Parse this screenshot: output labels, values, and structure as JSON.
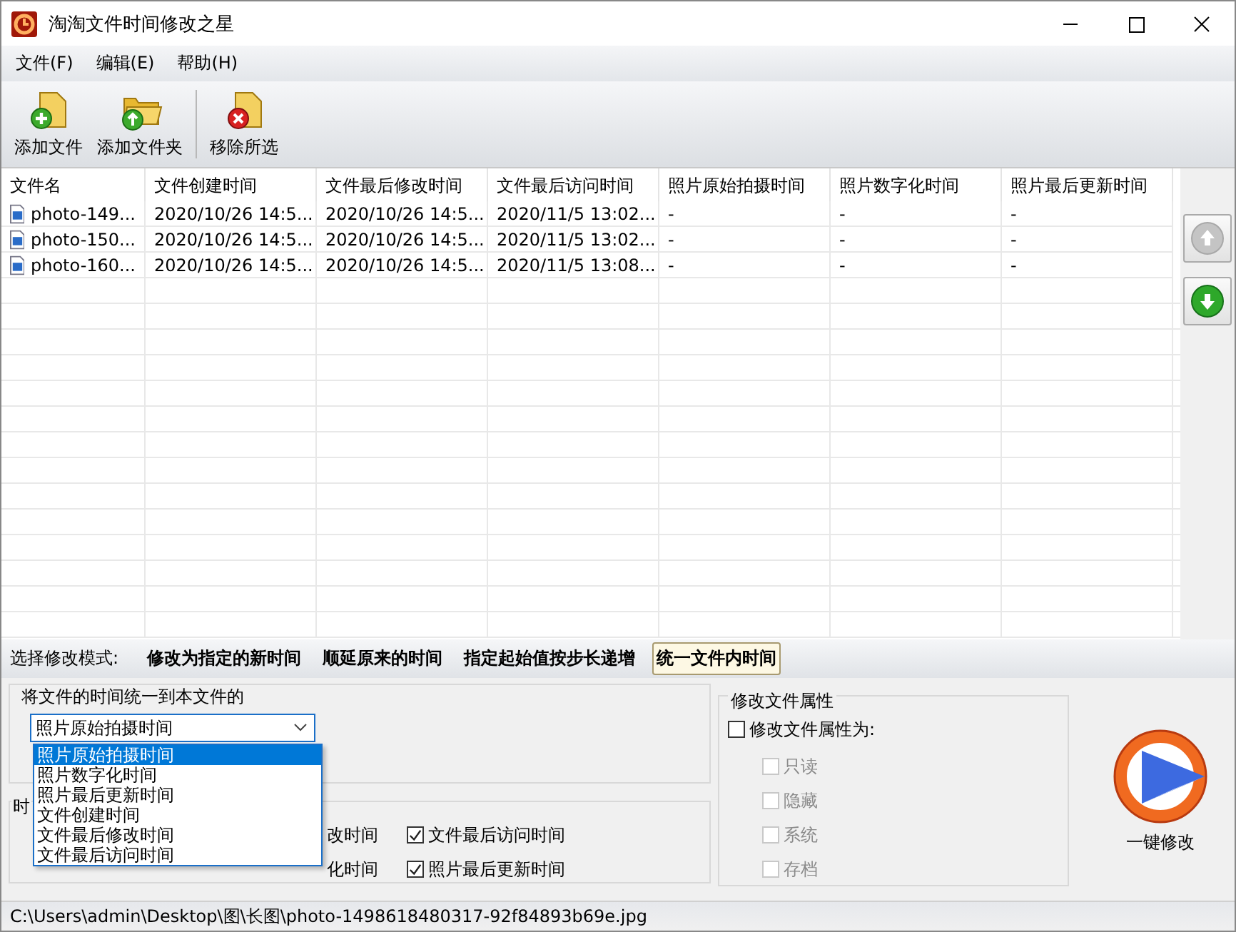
{
  "window": {
    "title": "淘淘文件时间修改之星"
  },
  "menu": [
    {
      "label": "文件(F)"
    },
    {
      "label": "编辑(E)"
    },
    {
      "label": "帮助(H)"
    }
  ],
  "toolbar": [
    {
      "label": "添加文件",
      "kind": "add-file"
    },
    {
      "label": "添加文件夹",
      "kind": "add-folder"
    },
    {
      "label": "移除所选",
      "kind": "remove"
    }
  ],
  "table": {
    "columns": [
      "文件名",
      "文件创建时间",
      "文件最后修改时间",
      "文件最后访问时间",
      "照片原始拍摄时间",
      "照片数字化时间",
      "照片最后更新时间"
    ],
    "rows": [
      {
        "cells": [
          "photo-149...",
          "2020/10/26 14:5...",
          "2020/10/26 14:5...",
          "2020/11/5 13:02...",
          "-",
          "-",
          "-"
        ]
      },
      {
        "cells": [
          "photo-150...",
          "2020/10/26 14:5...",
          "2020/10/26 14:5...",
          "2020/11/5 13:02...",
          "-",
          "-",
          "-"
        ]
      },
      {
        "cells": [
          "photo-160...",
          "2020/10/26 14:5...",
          "2020/10/26 14:5...",
          "2020/11/5 13:08...",
          "-",
          "-",
          "-"
        ]
      }
    ]
  },
  "side_buttons": [
    {
      "kind": "up",
      "disabled": true
    },
    {
      "kind": "down",
      "disabled": false
    }
  ],
  "mode": {
    "label": "选择修改模式:",
    "options": [
      {
        "label": "修改为指定的新时间",
        "selected": false
      },
      {
        "label": "顺延原来的时间",
        "selected": false
      },
      {
        "label": "指定起始值按步长递增",
        "selected": false
      },
      {
        "label": "统一文件内时间",
        "selected": true
      }
    ]
  },
  "unify_group": {
    "title": "将文件的时间统一到本文件的",
    "select": {
      "value": "照片原始拍摄时间",
      "options": [
        {
          "label": "照片原始拍摄时间",
          "selected": true
        },
        {
          "label": "照片数字化时间",
          "selected": false
        },
        {
          "label": "照片最后更新时间",
          "selected": false
        },
        {
          "label": "文件创建时间",
          "selected": false
        },
        {
          "label": "文件最后修改时间",
          "selected": false
        },
        {
          "label": "文件最后访问时间",
          "selected": false
        }
      ]
    }
  },
  "time_group": {
    "title": "时",
    "partial_labels": [
      "改时间",
      "化时间"
    ],
    "checks": [
      {
        "label": "文件最后访问时间",
        "checked": true
      },
      {
        "label": "照片最后更新时间",
        "checked": true
      }
    ]
  },
  "attr_group": {
    "title": "修改文件属性",
    "master": {
      "label": "修改文件属性为:",
      "checked": false
    },
    "options": [
      {
        "label": "只读",
        "checked": false,
        "disabled": true
      },
      {
        "label": "隐藏",
        "checked": false,
        "disabled": true
      },
      {
        "label": "系统",
        "checked": false,
        "disabled": true
      },
      {
        "label": "存档",
        "checked": false,
        "disabled": true
      }
    ]
  },
  "run_button": {
    "label": "一键修改"
  },
  "status_bar": {
    "path": "C:\\Users\\admin\\Desktop\\图\\长图\\photo-1498618480317-92f84893b69e.jpg"
  }
}
